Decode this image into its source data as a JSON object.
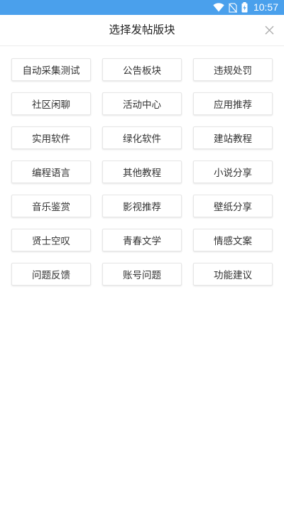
{
  "status_bar": {
    "time": "10:57",
    "wifi_icon": "wifi-icon",
    "no_sim_icon": "no-sim-icon",
    "battery_icon": "battery-charging-icon",
    "color": "#4aa0ec"
  },
  "header": {
    "title": "选择发帖版块",
    "close_icon": "close-icon"
  },
  "boards": [
    {
      "label": "自动采集测试"
    },
    {
      "label": "公告板块"
    },
    {
      "label": "违规处罚"
    },
    {
      "label": "社区闲聊"
    },
    {
      "label": "活动中心"
    },
    {
      "label": "应用推荐"
    },
    {
      "label": "实用软件"
    },
    {
      "label": "绿化软件"
    },
    {
      "label": "建站教程"
    },
    {
      "label": "编程语言"
    },
    {
      "label": "其他教程"
    },
    {
      "label": "小说分享"
    },
    {
      "label": "音乐鉴赏"
    },
    {
      "label": "影视推荐"
    },
    {
      "label": "壁纸分享"
    },
    {
      "label": "贤士空叹"
    },
    {
      "label": "青春文学"
    },
    {
      "label": "情感文案"
    },
    {
      "label": "问题反馈"
    },
    {
      "label": "账号问题"
    },
    {
      "label": "功能建议"
    }
  ]
}
